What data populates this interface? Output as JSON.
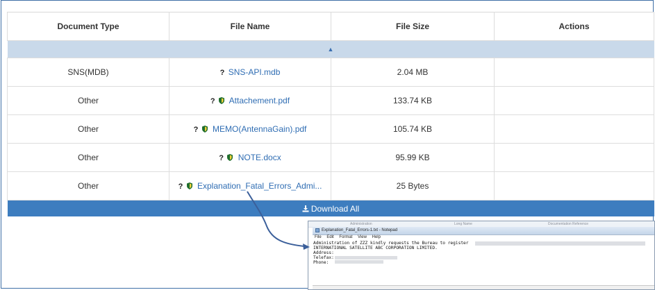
{
  "table": {
    "headers": [
      "Document Type",
      "File Name",
      "File Size",
      "Actions"
    ],
    "sort_indicator": "▲",
    "rows": [
      {
        "type": "SNS(MDB)",
        "name": "SNS-API.mdb",
        "size": "2.04 MB",
        "actions": "",
        "icons": [
          "question-icon"
        ]
      },
      {
        "type": "Other",
        "name": "Attachement.pdf",
        "size": "133.74 KB",
        "actions": "",
        "icons": [
          "question-icon",
          "shield-icon"
        ]
      },
      {
        "type": "Other",
        "name": "MEMO(AntennaGain).pdf",
        "size": "105.74 KB",
        "actions": "",
        "icons": [
          "question-icon",
          "shield-icon"
        ]
      },
      {
        "type": "Other",
        "name": "NOTE.docx",
        "size": "95.99 KB",
        "actions": "",
        "icons": [
          "question-icon",
          "shield-icon"
        ]
      },
      {
        "type": "Other",
        "name": "Explanation_Fatal_Errors_Admi...",
        "size": "25 Bytes",
        "actions": "",
        "icons": [
          "question-icon",
          "shield-icon"
        ]
      }
    ],
    "question_glyph": "?",
    "download_all_label": "Download All"
  },
  "notepad": {
    "header_strip": [
      "Administration",
      "Long Name",
      "Documentation Reference"
    ],
    "title": "Explanation_Fatal_Errors-1.txt - Notepad",
    "menu": [
      "File",
      "Edit",
      "Format",
      "View",
      "Help"
    ],
    "lines": [
      "Administration of ZZZ kindly requests the Bureau to register",
      "",
      "INTERNATIONAL SATELLITE ABC CORPORATION LIMITED.",
      "Address:",
      "Telefax:",
      "Phone:"
    ]
  },
  "colors": {
    "link": "#2f6db3",
    "sort_row_bg": "#c9d9ea",
    "download_bar_bg": "#3d7dbf",
    "shield": "#1f6e2e",
    "arrow": "#3b5f9a"
  }
}
